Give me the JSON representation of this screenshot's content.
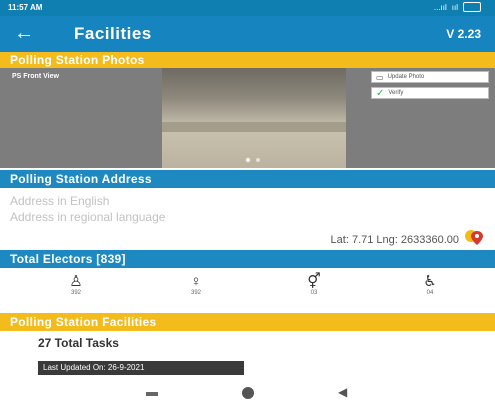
{
  "status_bar": {
    "time": "11:57 AM",
    "network": "...ııl",
    "wifi": "ııl"
  },
  "app_bar": {
    "back_icon": "arrow-left-icon",
    "title": "Facilities",
    "version": "V 2.23"
  },
  "photos": {
    "header": "Polling Station Photos",
    "front_view_label": "PS Front View",
    "update_photo_label": "Update Photo",
    "verify_label": "Verify"
  },
  "address": {
    "header": "Polling Station Address",
    "english_placeholder": "Address in English",
    "regional_placeholder": "Address in regional language",
    "latlng": "Lat: 7.71 Lng: 2633360.00"
  },
  "electors": {
    "header": "Total Electors [839]",
    "items": [
      {
        "icon": "male-voter-icon",
        "count": "392"
      },
      {
        "icon": "female-voter-icon",
        "count": "392"
      },
      {
        "icon": "third-gender-icon",
        "count": "03"
      },
      {
        "icon": "wheelchair-icon",
        "count": "04"
      }
    ]
  },
  "facilities": {
    "header": "Polling Station Facilities",
    "total_tasks": "27 Total Tasks",
    "last_updated": "Last Updated On: 26-9-2021"
  },
  "colors": {
    "app_bar": "#1584bf",
    "section_yellow": "#f4bb1c",
    "section_blue": "#1d89c0"
  }
}
